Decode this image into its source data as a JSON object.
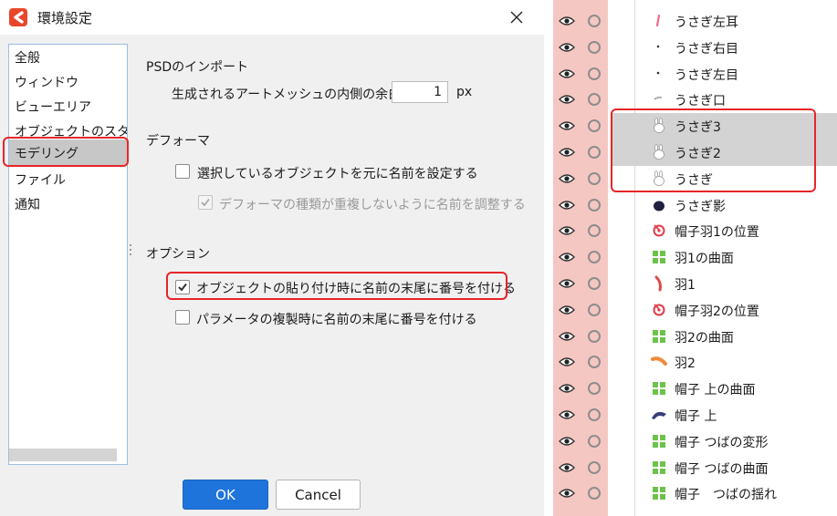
{
  "dialog": {
    "title": "環境設定",
    "nav_items": [
      "全般",
      "ウィンドウ",
      "ビューエリア",
      "オブジェクトのスタイル",
      "モデリング",
      "ファイル",
      "通知"
    ],
    "selected_nav": "モデリング",
    "psd_section": "PSDのインポート",
    "mesh_margin_label": "生成されるアートメッシュの内側の余白",
    "mesh_margin_value": "1",
    "mesh_margin_unit": "px",
    "deformer_section": "デフォーマ",
    "deformer_name_label": "選択しているオブジェクトを元に名前を設定する",
    "deformer_name_checked": false,
    "deformer_dup_label": "デフォーマの種類が重複しないように名前を調整する",
    "deformer_dup_checked": true,
    "deformer_dup_disabled": true,
    "options_section": "オプション",
    "paste_label": "オブジェクトの貼り付け時に名前の末尾に番号を付ける",
    "paste_checked": true,
    "param_dup_label": "パラメータの複製時に名前の末尾に番号を付ける",
    "param_dup_checked": false,
    "ok_label": "OK",
    "cancel_label": "Cancel"
  },
  "colors": {
    "highlight": "#e5262a",
    "ok_button": "#1f74dc",
    "visibility_column": "#f5c7c2",
    "selected_row": "#d3d3d3"
  },
  "object_tree": [
    {
      "label": "うさぎ左耳",
      "icon": "ear-stroke-icon",
      "selected": false
    },
    {
      "label": "うさぎ右目",
      "icon": "small-dot-icon",
      "selected": false
    },
    {
      "label": "うさぎ左目",
      "icon": "small-dot-icon",
      "selected": false
    },
    {
      "label": "うさぎ口",
      "icon": "mouth-stroke-icon",
      "selected": false
    },
    {
      "label": "うさぎ3",
      "icon": "rabbit-icon",
      "selected": true
    },
    {
      "label": "うさぎ2",
      "icon": "rabbit-icon",
      "selected": true
    },
    {
      "label": "うさぎ",
      "icon": "rabbit-icon",
      "selected": false
    },
    {
      "label": "うさぎ影",
      "icon": "dark-blob-icon",
      "selected": false
    },
    {
      "label": "帽子羽1の位置",
      "icon": "rotation-deformer-icon",
      "selected": false
    },
    {
      "label": "羽1の曲面",
      "icon": "warp-deformer-icon",
      "selected": false
    },
    {
      "label": "羽1",
      "icon": "red-feather-icon",
      "selected": false
    },
    {
      "label": "帽子羽2の位置",
      "icon": "rotation-deformer-icon",
      "selected": false
    },
    {
      "label": "羽2の曲面",
      "icon": "warp-deformer-icon",
      "selected": false
    },
    {
      "label": "羽2",
      "icon": "orange-feather-icon",
      "selected": false
    },
    {
      "label": "帽子 上の曲面",
      "icon": "warp-deformer-icon",
      "selected": false
    },
    {
      "label": "帽子 上",
      "icon": "hat-top-icon",
      "selected": false
    },
    {
      "label": "帽子 つばの変形",
      "icon": "warp-deformer-icon",
      "selected": false
    },
    {
      "label": "帽子 つばの曲面",
      "icon": "warp-deformer-icon",
      "selected": false
    },
    {
      "label": "帽子　つばの揺れ",
      "icon": "warp-deformer-icon",
      "selected": false
    }
  ]
}
